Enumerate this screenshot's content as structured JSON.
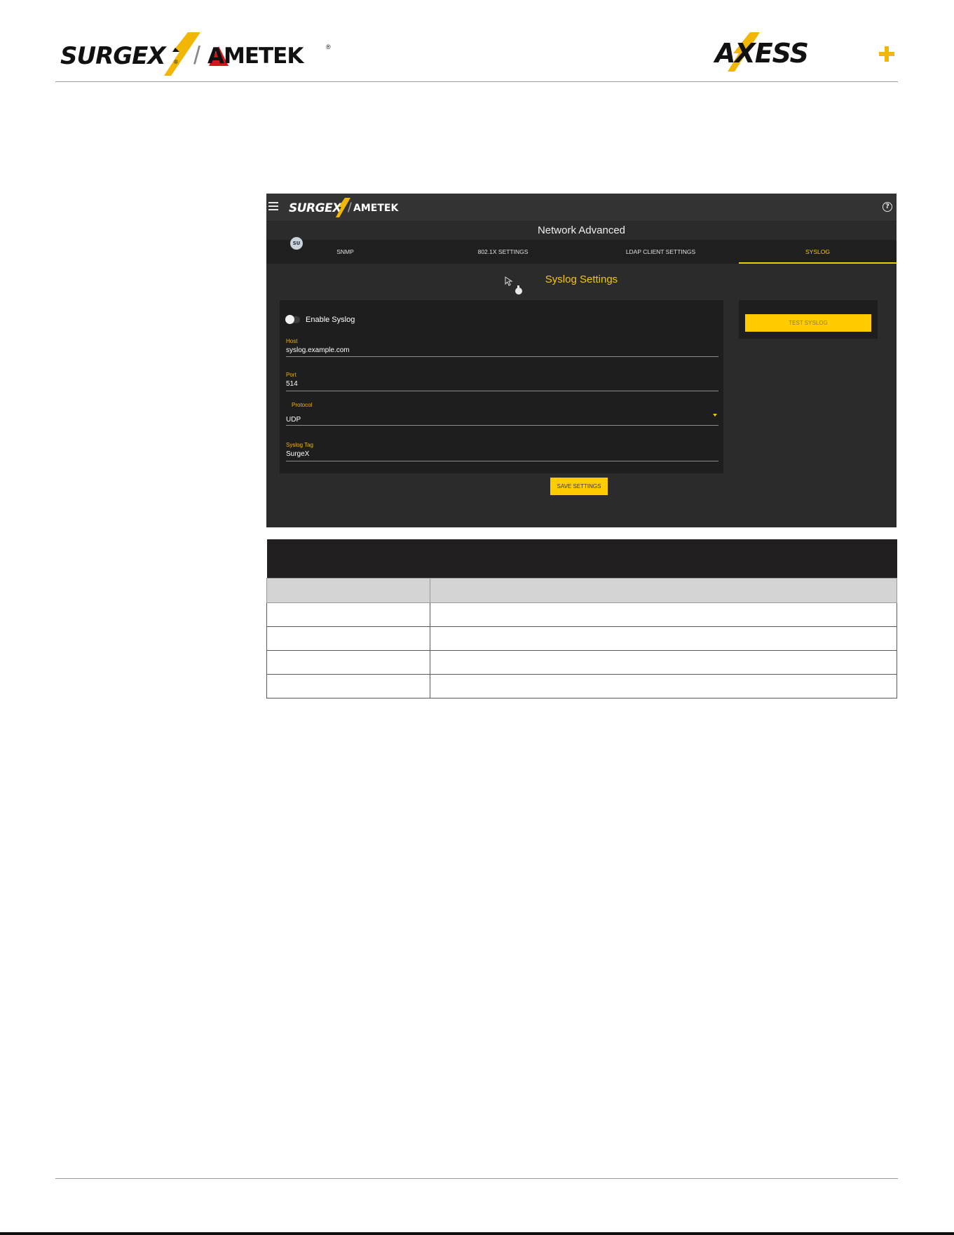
{
  "header": {
    "brand_left": {
      "surgex": "SURGEX",
      "ametek": "AMETEK",
      "registered": "®"
    },
    "brand_right": {
      "axess": "AXESS"
    },
    "accent_color": "#f2b705"
  },
  "app": {
    "brand": {
      "surgex": "SURGEX",
      "ametek": "AMETEK"
    },
    "help_symbol": "?",
    "page_title": "Network Advanced",
    "avatar_initials": "SU",
    "tabs": [
      {
        "label": "SNMP",
        "active": false
      },
      {
        "label": "802.1X SETTINGS",
        "active": false
      },
      {
        "label": "LDAP CLIENT SETTINGS",
        "active": false
      },
      {
        "label": "SYSLOG",
        "active": true
      }
    ],
    "section_title": "Syslog Settings",
    "enable_syslog": {
      "label": "Enable Syslog",
      "enabled": false
    },
    "fields": {
      "host": {
        "label": "Host",
        "value": "syslog.example.com"
      },
      "port": {
        "label": "Port",
        "value": "514"
      },
      "protocol": {
        "label": "Protocol",
        "value": "UDP"
      },
      "syslog_tag": {
        "label": "Syslog Tag",
        "value": "SurgeX"
      }
    },
    "buttons": {
      "test_syslog": "TEST SYSLOG",
      "save_settings": "SAVE SETTINGS"
    },
    "accent_color": "#ffcc00"
  },
  "table": {
    "rows": 4
  }
}
